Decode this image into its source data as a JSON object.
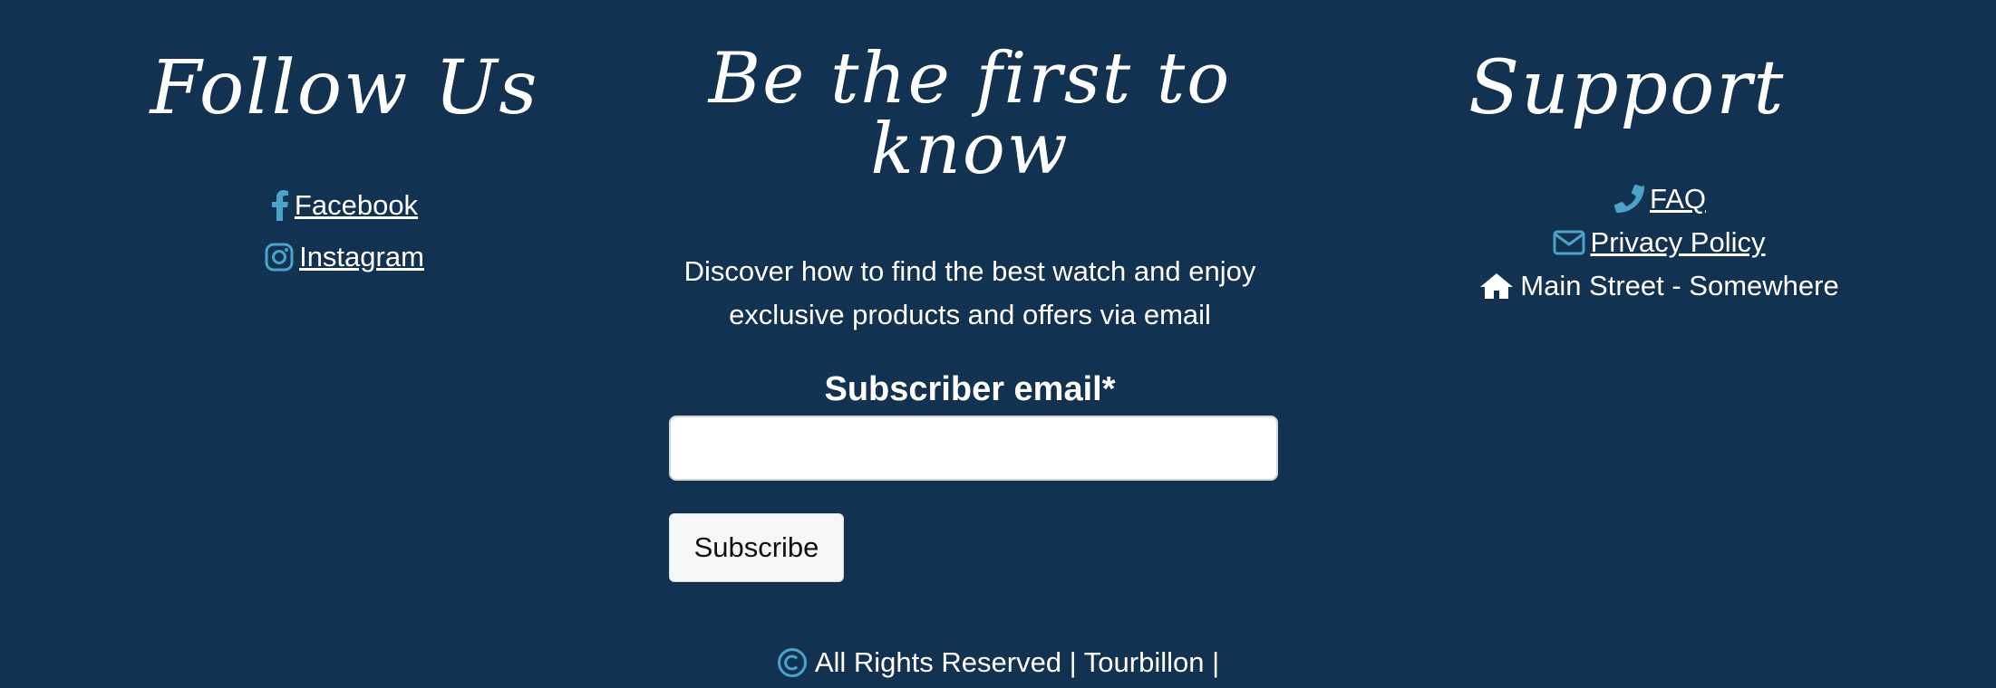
{
  "follow": {
    "title": "Follow Us",
    "links": [
      {
        "label": " Facebook",
        "icon": "facebook-icon"
      },
      {
        "label": " Instagram",
        "icon": "instagram-icon"
      }
    ]
  },
  "newsletter": {
    "title_line1": "Be the first to",
    "title_line2": "know",
    "description_line1": "Discover how to find the best watch and enjoy",
    "description_line2": "exclusive products and offers via email",
    "email_label": "Subscriber email*",
    "email_value": "",
    "subscribe_label": "Subscribe"
  },
  "support": {
    "title": "Support",
    "items": [
      {
        "label": "FAQ",
        "icon": "phone-icon",
        "link": true
      },
      {
        "label": " Privacy Policy",
        "icon": "envelope-icon",
        "link": true
      },
      {
        "label": " Main Street - Somewhere",
        "icon": "home-icon",
        "link": false
      }
    ]
  },
  "footer": {
    "text": " All Rights Reserved | Tourbillon |",
    "icon": "copyright-icon"
  },
  "colors": {
    "background": "#123252",
    "accent_icon": "#4aa3c8",
    "text": "#ffffff"
  }
}
